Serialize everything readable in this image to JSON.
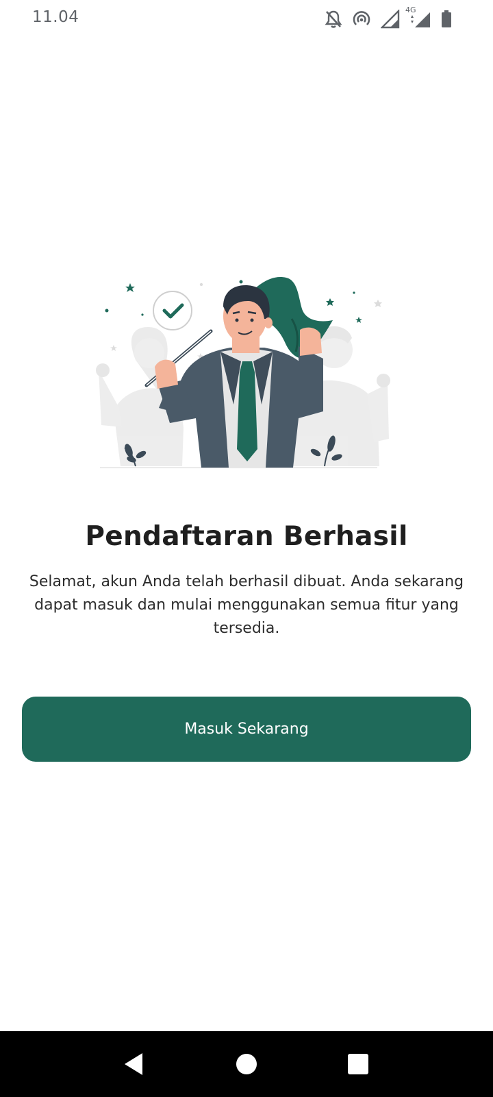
{
  "status_bar": {
    "time": "11.04",
    "network_label": "4G",
    "icons": [
      "notifications-off-icon",
      "hotspot-icon",
      "signal-icon",
      "signal-4g-icon",
      "battery-icon"
    ]
  },
  "illustration": {
    "name": "success-illustration",
    "accent_color": "#1f6a5a"
  },
  "content": {
    "title": "Pendaftaran Berhasil",
    "description": "Selamat, akun Anda telah berhasil dibuat. Anda sekarang dapat masuk dan mulai menggunakan semua fitur yang tersedia."
  },
  "actions": {
    "primary_label": "Masuk Sekarang",
    "primary_color": "#1f6a5a"
  },
  "nav_bar": {
    "buttons": [
      "back-icon",
      "home-icon",
      "recents-icon"
    ]
  }
}
